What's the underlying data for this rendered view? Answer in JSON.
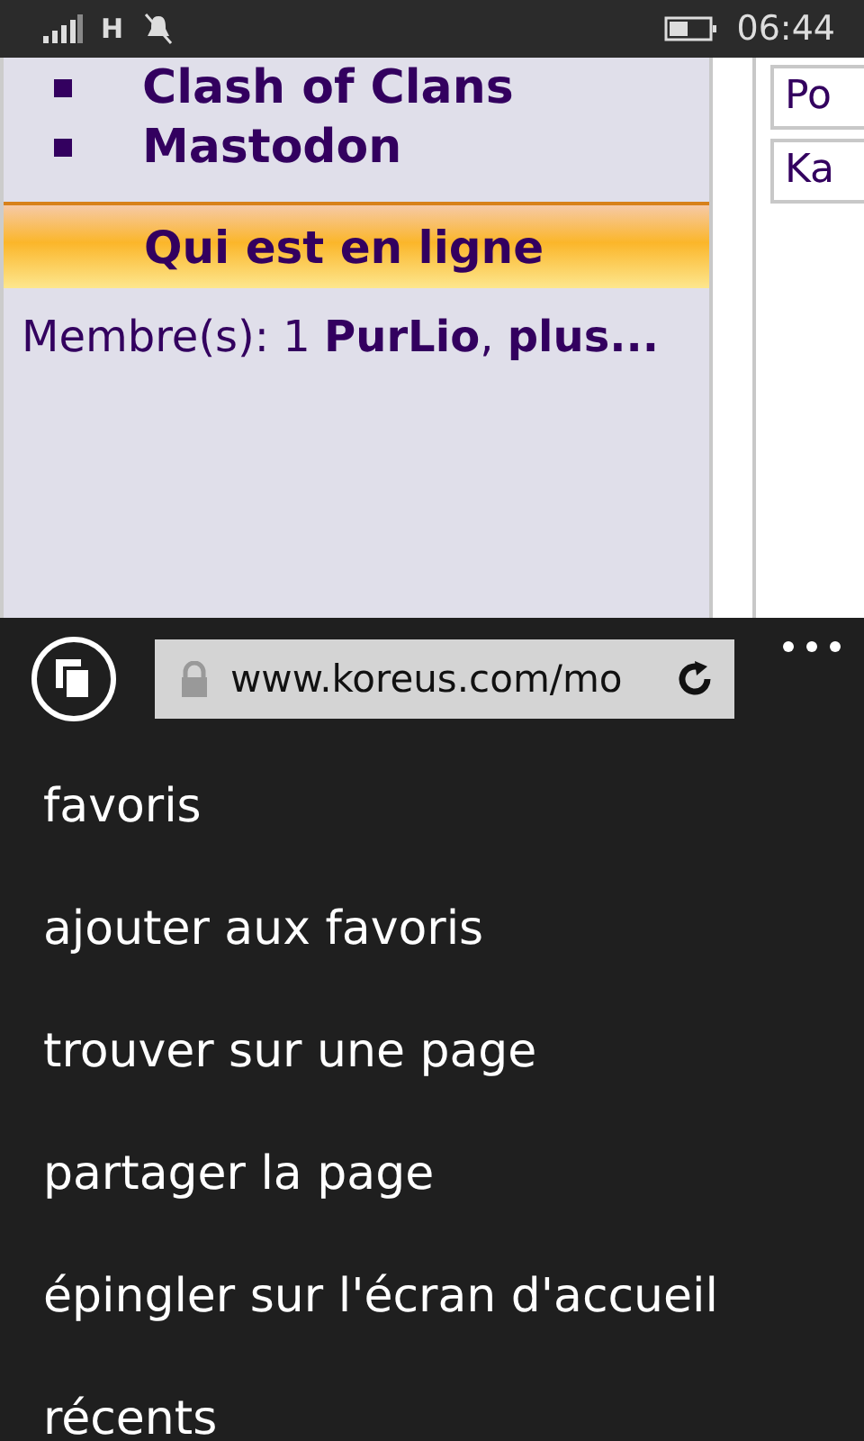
{
  "status_bar": {
    "network": "H",
    "time": "06:44"
  },
  "page": {
    "games": [
      "Clash of Clans",
      "Mastodon"
    ],
    "online": {
      "title": "Qui est en ligne",
      "text": "Membre(s): 1 **PurLio**, **plus...**"
    },
    "side_fields": [
      "Po",
      "Ka"
    ]
  },
  "address_bar": {
    "url": "www.koreus.com/mo"
  },
  "menu": [
    "favoris",
    "ajouter aux favoris",
    "trouver sur une page",
    "partager la page",
    "épingler sur l'écran d'accueil",
    "récents"
  ]
}
